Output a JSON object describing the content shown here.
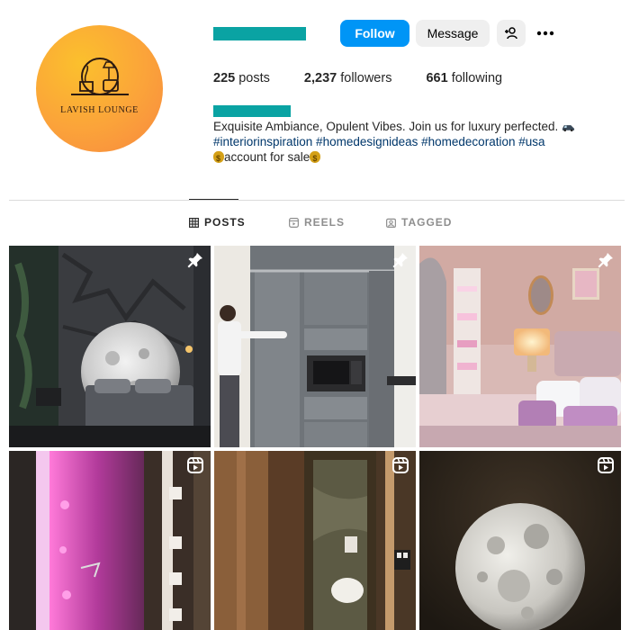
{
  "profile": {
    "brand_text": "LAVISH LOUNGE",
    "username_redacted_color": "#0aa3a3"
  },
  "actions": {
    "follow_label": "Follow",
    "message_label": "Message",
    "add_user_icon": "person-add-icon",
    "more_icon": "more-dots-icon"
  },
  "stats": {
    "posts_count": "225",
    "posts_label": "posts",
    "followers_count": "2,237",
    "followers_label": "followers",
    "following_count": "661",
    "following_label": "following"
  },
  "bio": {
    "line1": "Exquisite Ambiance, Opulent Vibes. Join us for luxury perfected.",
    "line2": "#interiorinspiration #homedesignideas #homedecoration #usa",
    "line3": "account for sale"
  },
  "tabs": [
    {
      "label": "POSTS",
      "icon": "grid-icon",
      "active": true
    },
    {
      "label": "REELS",
      "icon": "reels-icon",
      "active": false
    },
    {
      "label": "TAGGED",
      "icon": "tagged-icon",
      "active": false
    }
  ],
  "posts": [
    {
      "badge": "pin-icon",
      "subject": "moon-wall-bedroom"
    },
    {
      "badge": "pin-icon",
      "subject": "grey-kitchen-cabinet"
    },
    {
      "badge": "pin-icon",
      "subject": "pink-luxury-bedroom"
    },
    {
      "badge": "reel-icon",
      "subject": "pink-led-wall-panel"
    },
    {
      "badge": "reel-icon",
      "subject": "hidden-door-bathroom"
    },
    {
      "badge": "reel-icon",
      "subject": "moon-lamp"
    }
  ],
  "colors": {
    "accent": "#0095f6",
    "secondary_button": "#efefef",
    "hashtag": "#00376b",
    "avatar_gradient": [
      "#fbc02d",
      "#f7883f"
    ]
  }
}
